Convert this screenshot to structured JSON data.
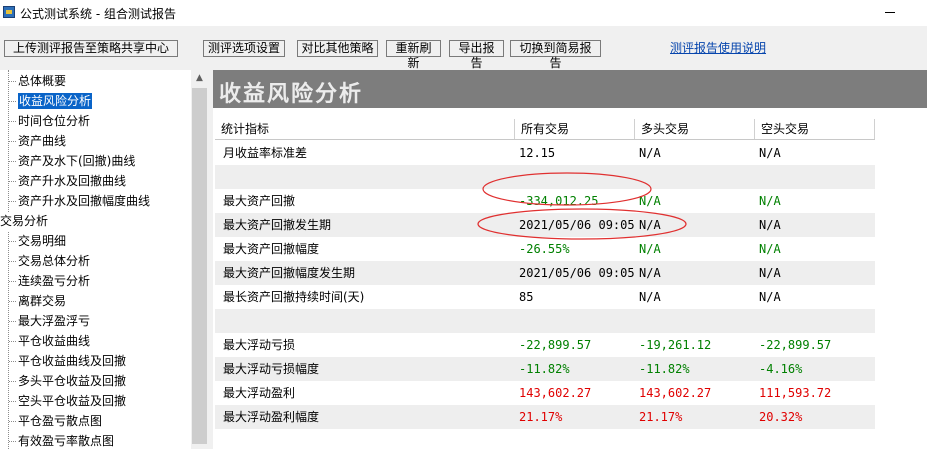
{
  "window": {
    "title": "公式测试系统 - 组合测试报告"
  },
  "toolbar": {
    "upload_label": "上传测评报告至策略共享中心",
    "options_label": "测评选项设置",
    "compare_label": "对比其他策略",
    "refresh_label": "重新刷新",
    "export_label": "导出报告",
    "simple_label": "切换到简易报告",
    "help_link": "测评报告使用说明"
  },
  "sidebar": {
    "items": [
      {
        "label": "总体概要",
        "level": 1
      },
      {
        "label": "收益风险分析",
        "level": 1,
        "selected": true
      },
      {
        "label": "时间仓位分析",
        "level": 1
      },
      {
        "label": "资产曲线",
        "level": 1
      },
      {
        "label": "资产及水下(回撤)曲线",
        "level": 1
      },
      {
        "label": "资产升水及回撤曲线",
        "level": 1
      },
      {
        "label": "资产升水及回撤幅度曲线",
        "level": 1
      },
      {
        "label": "交易分析",
        "level": 0
      },
      {
        "label": "交易明细",
        "level": 1
      },
      {
        "label": "交易总体分析",
        "level": 1
      },
      {
        "label": "连续盈亏分析",
        "level": 1
      },
      {
        "label": "离群交易",
        "level": 1
      },
      {
        "label": "最大浮盈浮亏",
        "level": 1
      },
      {
        "label": "平仓收益曲线",
        "level": 1
      },
      {
        "label": "平仓收益曲线及回撤",
        "level": 1
      },
      {
        "label": "多头平仓收益及回撤",
        "level": 1
      },
      {
        "label": "空头平仓收益及回撤",
        "level": 1
      },
      {
        "label": "平仓盈亏散点图",
        "level": 1
      },
      {
        "label": "有效盈亏率散点图",
        "level": 1
      }
    ]
  },
  "main": {
    "section_title": "收益风险分析",
    "columns": [
      "统计指标",
      "所有交易",
      "多头交易",
      "空头交易"
    ],
    "rows": [
      {
        "label": "月收益率标准差",
        "all": "12.15",
        "long": "N/A",
        "short": "N/A",
        "color": "normal"
      },
      {
        "label": "",
        "all": "",
        "long": "",
        "short": "",
        "color": "normal"
      },
      {
        "label": "最大资产回撤",
        "all": "-334,012.25",
        "long": "N/A",
        "short": "N/A",
        "color": "green"
      },
      {
        "label": "最大资产回撤发生期",
        "all": "2021/05/06 09:05",
        "long": "N/A",
        "short": "N/A",
        "color": "normal"
      },
      {
        "label": "最大资产回撤幅度",
        "all": "-26.55%",
        "long": "N/A",
        "short": "N/A",
        "color": "green"
      },
      {
        "label": "最大资产回撤幅度发生期",
        "all": "2021/05/06 09:05",
        "long": "N/A",
        "short": "N/A",
        "color": "normal"
      },
      {
        "label": "最长资产回撤持续时间(天)",
        "all": "85",
        "long": "N/A",
        "short": "N/A",
        "color": "normal"
      },
      {
        "label": "",
        "all": "",
        "long": "",
        "short": "",
        "color": "normal"
      },
      {
        "label": "最大浮动亏损",
        "all": "-22,899.57",
        "long": "-19,261.12",
        "short": "-22,899.57",
        "color": "green"
      },
      {
        "label": "最大浮动亏损幅度",
        "all": "-11.82%",
        "long": "-11.82%",
        "short": "-4.16%",
        "color": "green"
      },
      {
        "label": "最大浮动盈利",
        "all": "143,602.27",
        "long": "143,602.27",
        "short": "111,593.72",
        "color": "red"
      },
      {
        "label": "最大浮动盈利幅度",
        "all": "21.17%",
        "long": "21.17%",
        "short": "20.32%",
        "color": "red"
      }
    ]
  },
  "colors": {
    "selection": "#0a64c8",
    "banner": "#7d7d7d",
    "positive": "#e00000",
    "negative": "#008000",
    "annotation": "#e03030",
    "link": "#0645ad"
  }
}
